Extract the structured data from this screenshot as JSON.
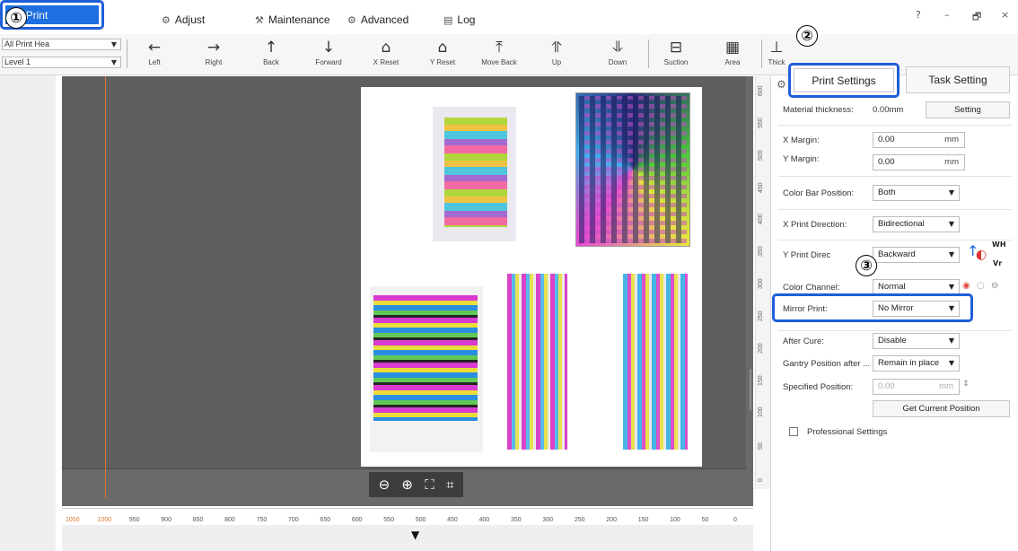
{
  "callouts": [
    "①",
    "②",
    "③"
  ],
  "menu": {
    "tabs": [
      {
        "label": "Print",
        "icon": "print-icon"
      },
      {
        "label": "Adjust",
        "icon": "adjust-icon"
      },
      {
        "label": "Maintenance",
        "icon": "maintenance-icon"
      },
      {
        "label": "Advanced",
        "icon": "advanced-icon"
      },
      {
        "label": "Log",
        "icon": "log-icon"
      }
    ],
    "window_controls": [
      "?",
      "–",
      "🗗",
      "×"
    ]
  },
  "toolbar": {
    "head_select": "All Print Hea",
    "level_select": "Level 1",
    "buttons": [
      {
        "label": "Left",
        "icon": "arrow-left-icon"
      },
      {
        "label": "Right",
        "icon": "arrow-right-icon"
      },
      {
        "label": "Back",
        "icon": "arrow-up-icon"
      },
      {
        "label": "Forward",
        "icon": "arrow-down-icon"
      },
      {
        "label": "X Reset",
        "icon": "x-reset-icon"
      },
      {
        "label": "Y Reset",
        "icon": "y-reset-icon"
      },
      {
        "label": "Move Back",
        "icon": "move-back-icon"
      },
      {
        "label": "Up",
        "icon": "up-icon"
      },
      {
        "label": "Down",
        "icon": "down-icon"
      },
      {
        "label": "Suction",
        "icon": "suction-icon"
      },
      {
        "label": "Area",
        "icon": "area-icon"
      },
      {
        "label": "Thick",
        "icon": "thickness-icon"
      }
    ]
  },
  "ruler": {
    "h_labels": [
      "1050",
      "1000",
      "950",
      "900",
      "850",
      "800",
      "750",
      "700",
      "650",
      "600",
      "550",
      "500",
      "450",
      "400",
      "350",
      "300",
      "250",
      "200",
      "150",
      "100",
      "50",
      "0"
    ],
    "v_labels": [
      "600",
      "550",
      "500",
      "450",
      "400",
      "350",
      "300",
      "250",
      "200",
      "150",
      "100",
      "50",
      "0"
    ]
  },
  "panel": {
    "tabs": {
      "print_settings": "Print Settings",
      "task_setting": "Task Setting"
    },
    "material_thickness": {
      "label": "Material thickness:",
      "value": "0.00mm",
      "button": "Setting"
    },
    "x_margin": {
      "label": "X Margin:",
      "value": "0.00",
      "unit": "mm"
    },
    "y_margin": {
      "label": "Y Margin:",
      "value": "0.00",
      "unit": "mm"
    },
    "color_bar_position": {
      "label": "Color Bar Position:",
      "value": "Both"
    },
    "x_print_direction": {
      "label": "X Print Direction:",
      "value": "Bidirectional"
    },
    "y_print_direction": {
      "label": "Y Print Direc",
      "value": "Backward"
    },
    "color_channel": {
      "label": "Color Channel:",
      "value": "Normal"
    },
    "mirror_print": {
      "label": "Mirror Print:",
      "value": "No Mirror"
    },
    "after_cure": {
      "label": "After Cure:",
      "value": "Disable"
    },
    "gantry_position": {
      "label": "Gantry Position after ...",
      "value": "Remain in place"
    },
    "specified_position": {
      "label": "Specified Position:",
      "value": "0.00",
      "unit": "mm"
    },
    "get_current_position": "Get Current Position",
    "professional_settings": "Professional Settings",
    "wh_label": "WH",
    "vr_label": "Vr"
  },
  "colors": {
    "accent": "#1e6fe0",
    "highlight": "#1f5fd8",
    "origin_line": "#e2742c"
  }
}
